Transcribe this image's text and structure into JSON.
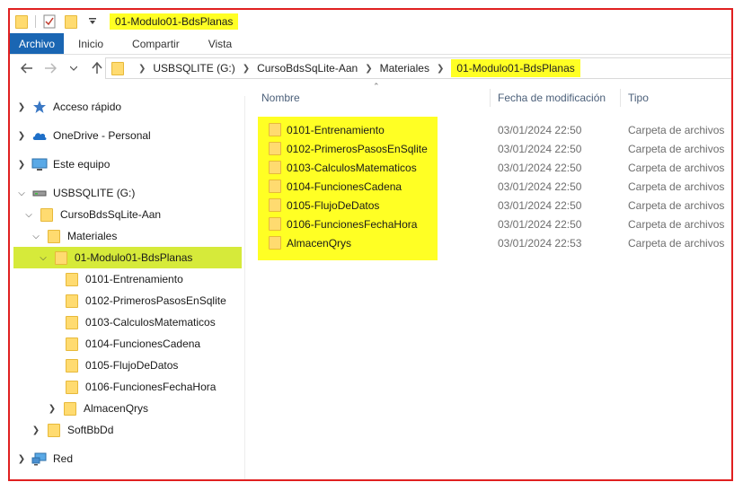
{
  "window": {
    "title": "01-Modulo01-BdsPlanas"
  },
  "ribbon": {
    "tabs": [
      {
        "label": "Archivo",
        "active": true
      },
      {
        "label": "Inicio"
      },
      {
        "label": "Compartir"
      },
      {
        "label": "Vista"
      }
    ]
  },
  "address": {
    "crumbs": [
      "USBSQLITE (G:)",
      "CursoBdsSqLite-Aan",
      "Materiales",
      "01-Modulo01-BdsPlanas"
    ]
  },
  "columns": {
    "name": "Nombre",
    "date": "Fecha de modificación",
    "type": "Tipo"
  },
  "files": [
    {
      "name": "0101-Entrenamiento",
      "date": "03/01/2024 22:50",
      "type": "Carpeta de archivos"
    },
    {
      "name": "0102-PrimerosPasosEnSqlite",
      "date": "03/01/2024 22:50",
      "type": "Carpeta de archivos"
    },
    {
      "name": "0103-CalculosMatematicos",
      "date": "03/01/2024 22:50",
      "type": "Carpeta de archivos"
    },
    {
      "name": "0104-FuncionesCadena",
      "date": "03/01/2024 22:50",
      "type": "Carpeta de archivos"
    },
    {
      "name": "0105-FlujoDeDatos",
      "date": "03/01/2024 22:50",
      "type": "Carpeta de archivos"
    },
    {
      "name": "0106-FuncionesFechaHora",
      "date": "03/01/2024 22:50",
      "type": "Carpeta de archivos"
    },
    {
      "name": "AlmacenQrys",
      "date": "03/01/2024 22:53",
      "type": "Carpeta de archivos"
    }
  ],
  "nav": {
    "quick_access": "Acceso rápido",
    "onedrive": "OneDrive - Personal",
    "this_pc": "Este equipo",
    "drive": "USBSQLITE (G:)",
    "course": "CursoBdsSqLite-Aan",
    "materials": "Materiales",
    "module": "01-Modulo01-BdsPlanas",
    "subfolders": [
      "0101-Entrenamiento",
      "0102-PrimerosPasosEnSqlite",
      "0103-CalculosMatematicos",
      "0104-FuncionesCadena",
      "0105-FlujoDeDatos",
      "0106-FuncionesFechaHora",
      "AlmacenQrys"
    ],
    "softbbdd": "SoftBbDd",
    "network": "Red"
  },
  "colors": {
    "highlight": "#ffff24",
    "selected": "#d6ea3a",
    "accent": "#1a66b3",
    "frame": "#e02020"
  },
  "icons": {
    "quick_access": "star-icon",
    "onedrive": "cloud-icon",
    "this_pc": "computer-icon",
    "drive": "usb-drive-icon",
    "network": "network-icon"
  }
}
